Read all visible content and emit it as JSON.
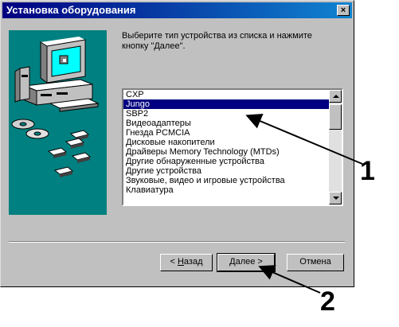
{
  "window": {
    "title": "Установка оборудования",
    "close_glyph": "×"
  },
  "instruction": "Выберите тип устройства из списка и нажмите кнопку \"Далее\".",
  "device_list": {
    "items": [
      "CXP",
      "Jungo",
      "SBP2",
      "Видеоадаптеры",
      "Гнезда PCMCIA",
      "Дисковые накопители",
      "Драйверы Memory Technology (MTDs)",
      "Другие обнаруженные устройства",
      "Другие устройства",
      "Звуковые, видео и игровые устройства",
      "Клавиатура"
    ],
    "selected_index": 1
  },
  "buttons": {
    "back_access": "Н",
    "back_rest": "азад",
    "back_prefix": "< ",
    "next_label": "Далее >",
    "cancel_label": "Отмена"
  },
  "annotations": {
    "label_1": "1",
    "label_2": "2"
  },
  "colors": {
    "title_start": "#000080",
    "title_end": "#1084d0",
    "illustration_bg": "#008080",
    "selection": "#000080"
  }
}
